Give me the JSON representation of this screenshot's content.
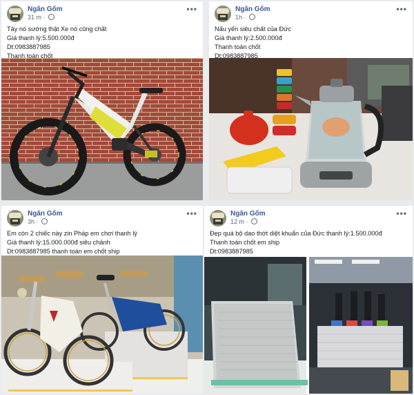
{
  "posts": [
    {
      "author": "Ngân Gốm",
      "time": "31 m",
      "lines": [
        "Tây nó sướng thật Xe nó cũng chất",
        "Giá thanh lý:5.500.000đ",
        "Dt:0983887985",
        "Thanh toán chốt"
      ],
      "image_desc": "e-bike"
    },
    {
      "author": "Ngân Gốm",
      "time": "1h",
      "lines": [
        "Nấu yến siêu chất của Đức",
        "Giá thanh lý:2.500.000đ",
        "Thanh toán chốt",
        "Dt:0983887985"
      ],
      "image_desc": "kettle"
    },
    {
      "author": "Ngân Gốm",
      "time": "3h",
      "lines": [
        "Em còn 2 chiếc này zin Pháp em chơi thanh lý",
        "Giá thanh lý:15.000.000đ siêu chảnh",
        "Dt:0983887985 thanh toán em chốt ship"
      ],
      "image_desc": "scooters"
    },
    {
      "author": "Ngân Gốm",
      "time": "12 m",
      "lines": [
        "Đẹp quá bộ dao thớt diệt khuẩn của Đức thanh lý:1.500.000đ",
        "Thanh toán chốt em ship",
        "Dt:0983887985"
      ],
      "image_desc": "knife-block"
    }
  ],
  "ui": {
    "more_symbol": "•••"
  }
}
